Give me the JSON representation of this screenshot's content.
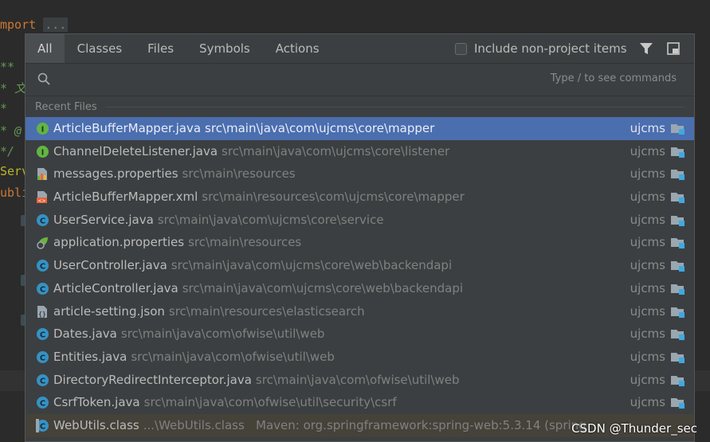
{
  "editor": {
    "lines": [
      {
        "a": "mport",
        "b": "..."
      },
      {
        "a": "**"
      },
      {
        "a": "* 文"
      },
      {
        "a": "*"
      },
      {
        "a": "* @"
      },
      {
        "a": "*/"
      },
      {
        "a": "Serv"
      },
      {
        "a": "ubli"
      }
    ]
  },
  "tabs": [
    "All",
    "Classes",
    "Files",
    "Symbols",
    "Actions"
  ],
  "include_label": "Include non-project items",
  "search": {
    "placeholder": "",
    "hint": "Type / to see commands"
  },
  "section_title": "Recent Files",
  "files": [
    {
      "name": "ArticleBufferMapper.java",
      "path": "src\\main\\java\\com\\ujcms\\core\\mapper",
      "project": "ujcms",
      "icon": "interface-icon",
      "selected": true
    },
    {
      "name": "ChannelDeleteListener.java",
      "path": "src\\main\\java\\com\\ujcms\\core\\listener",
      "project": "ujcms",
      "icon": "interface-icon"
    },
    {
      "name": "messages.properties",
      "path": "src\\main\\resources",
      "project": "ujcms",
      "icon": "properties-bundle-icon"
    },
    {
      "name": "ArticleBufferMapper.xml",
      "path": "src\\main\\resources\\com\\ujcms\\core\\mapper",
      "project": "ujcms",
      "icon": "xml-file-icon"
    },
    {
      "name": "UserService.java",
      "path": "src\\main\\java\\com\\ujcms\\core\\service",
      "project": "ujcms",
      "icon": "class-icon"
    },
    {
      "name": "application.properties",
      "path": "src\\main\\resources",
      "project": "ujcms",
      "icon": "spring-properties-icon"
    },
    {
      "name": "UserController.java",
      "path": "src\\main\\java\\com\\ujcms\\core\\web\\backendapi",
      "project": "ujcms",
      "icon": "class-icon"
    },
    {
      "name": "ArticleController.java",
      "path": "src\\main\\java\\com\\ujcms\\core\\web\\backendapi",
      "project": "ujcms",
      "icon": "class-icon"
    },
    {
      "name": "article-setting.json",
      "path": "src\\main\\resources\\elasticsearch",
      "project": "ujcms",
      "icon": "json-file-icon"
    },
    {
      "name": "Dates.java",
      "path": "src\\main\\java\\com\\ofwise\\util\\web",
      "project": "ujcms",
      "icon": "class-icon"
    },
    {
      "name": "Entities.java",
      "path": "src\\main\\java\\com\\ofwise\\util\\web",
      "project": "ujcms",
      "icon": "class-icon"
    },
    {
      "name": "DirectoryRedirectInterceptor.java",
      "path": "src\\main\\java\\com\\ofwise\\util\\web",
      "project": "ujcms",
      "icon": "class-icon"
    },
    {
      "name": "CsrfToken.java",
      "path": "src\\main\\java\\com\\ofwise\\util\\security\\csrf",
      "project": "ujcms",
      "icon": "class-icon"
    }
  ],
  "maven_row": {
    "name": "WebUtils.class",
    "path": "...\\WebUtils.class",
    "info": "Maven: org.springframework:spring-web:5.3.14 (spring"
  },
  "watermark": "CSDN @Thunder_sec",
  "colors": {
    "popup_bg": "#3c3f41",
    "selection": "#4b6eaf",
    "class_icon": "#3592c4",
    "interface_icon": "#62b543"
  }
}
